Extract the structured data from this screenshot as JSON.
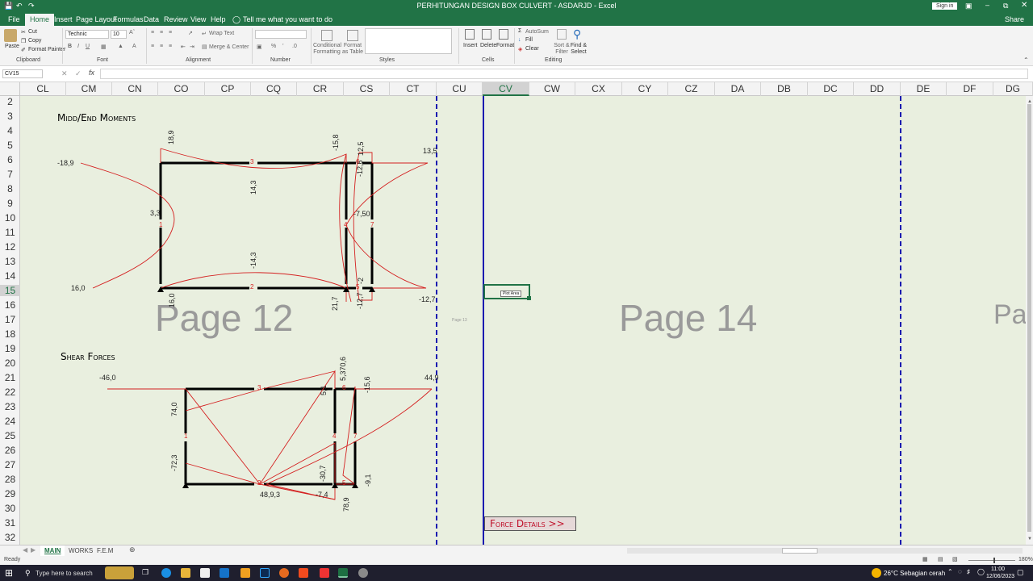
{
  "window": {
    "title": "PERHITUNGAN DESIGN BOX CULVERT - ASDARJD - Excel",
    "sign_in": "Sign in"
  },
  "ribbon_tabs": [
    "File",
    "Home",
    "Insert",
    "Page Layout",
    "Formulas",
    "Data",
    "Review",
    "View",
    "Help"
  ],
  "tell_me": "Tell me what you want to do",
  "share": "Share",
  "clipboard": {
    "paste": "Paste",
    "cut": "Cut",
    "copy": "Copy",
    "format_painter": "Format Painter",
    "label": "Clipboard"
  },
  "font": {
    "name": "Technic",
    "size": "10",
    "label": "Font"
  },
  "alignment": {
    "wrap": "Wrap Text",
    "merge": "Merge & Center",
    "label": "Alignment"
  },
  "number": {
    "format": "",
    "percent": "%",
    "label": "Number"
  },
  "styles": {
    "conditional": "Conditional Formatting",
    "format_table": "Format as Table",
    "label": "Styles"
  },
  "cells": {
    "insert": "Insert",
    "delete": "Delete",
    "format": "Format",
    "label": "Cells"
  },
  "editing": {
    "autosum": "AutoSum",
    "fill": "Fill",
    "clear": "Clear",
    "sort": "Sort & Filter",
    "find": "Find & Select",
    "label": "Editing"
  },
  "formula_bar": {
    "name_box": "CV15",
    "fx": "fx",
    "value": ""
  },
  "columns": [
    "CL",
    "CM",
    "CN",
    "CO",
    "CP",
    "CQ",
    "CR",
    "CS",
    "CT",
    "CU",
    "CV",
    "CW",
    "CX",
    "CY",
    "CZ",
    "DA",
    "DB",
    "DC",
    "DD",
    "DE",
    "DF",
    "DG"
  ],
  "selected_column": "CV",
  "rows": [
    "2",
    "3",
    "4",
    "5",
    "6",
    "7",
    "8",
    "9",
    "10",
    "11",
    "12",
    "13",
    "14",
    "15",
    "16",
    "17",
    "18",
    "19",
    "20",
    "21",
    "22",
    "23",
    "24",
    "25",
    "26",
    "27",
    "28",
    "29",
    "30",
    "31",
    "32"
  ],
  "selected_row": "15",
  "sheet": {
    "moments_title": "Midd/End Moments",
    "shear_title": "Shear Forces",
    "page12": "Page 12",
    "page13": "Page 13",
    "page14": "Page 14",
    "page15_partial": "Pa",
    "plot_area": "Plot Area",
    "force_details": "Force Details >>",
    "moment_labels": {
      "m1": "-18,9",
      "m2": "18,9",
      "m3": "-15,8",
      "m4": "13,5",
      "m5": "-12,7",
      "m6": "14,3",
      "m7": "3,3",
      "m8": "-14,3",
      "m9": "16,0",
      "m10": "16,0",
      "m11": "21,7",
      "m12": "-7,50",
      "m13": "-12,6",
      "m14": "-12,7",
      "m15": "12,5",
      "m16": "-2"
    },
    "node_labels": [
      "1",
      "2",
      "3",
      "4",
      "5",
      "6",
      "7"
    ],
    "shear_labels": {
      "s1": "-46,0",
      "s2": "44,9",
      "s3": "74,0",
      "s4": "-72,3",
      "s5": "5,370,6",
      "s6": "-15,6",
      "s7": "5,1",
      "s8": "-30,7",
      "s9": "-9,1",
      "s10": "48,9,3",
      "s11": "-7,4",
      "s12": "78,9"
    }
  },
  "sheet_tabs": [
    "MAIN",
    "WORKS",
    "F.E.M"
  ],
  "status": {
    "ready": "Ready",
    "zoom": "180%"
  },
  "taskbar": {
    "search": "Type here to search",
    "weather": "26°C  Sebagian cerah",
    "time": "11:00",
    "date": "12/06/2023"
  },
  "colors": {
    "excel_green": "#217346",
    "sheet_bg": "#e9efdf",
    "diagram_red": "#d42020",
    "page_break": "#1a1ab0"
  }
}
